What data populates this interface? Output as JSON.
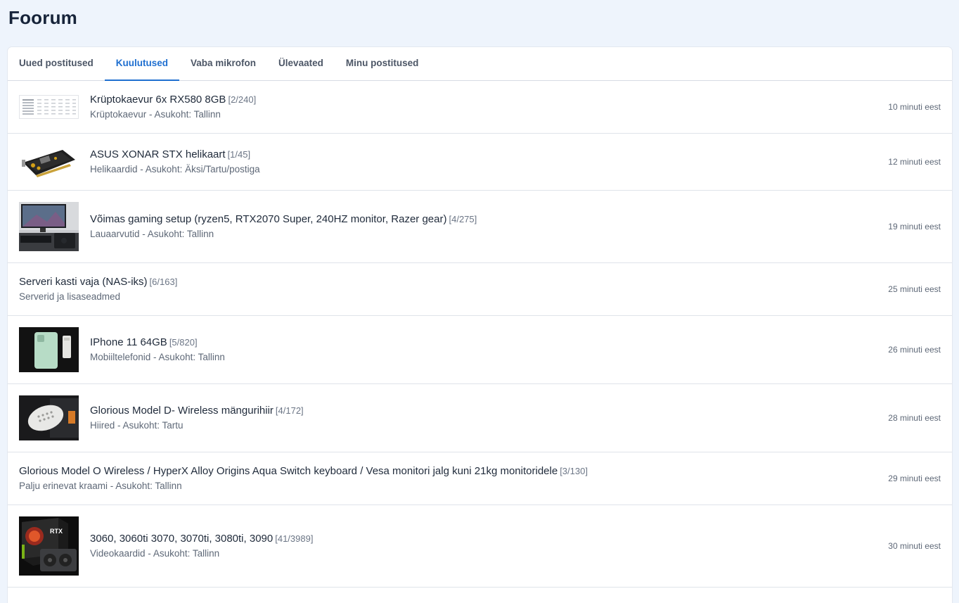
{
  "page": {
    "title": "Foorum"
  },
  "tabs": [
    {
      "label": "Uued postitused",
      "active": false
    },
    {
      "label": "Kuulutused",
      "active": true
    },
    {
      "label": "Vaba mikrofon",
      "active": false
    },
    {
      "label": "Ülevaated",
      "active": false
    },
    {
      "label": "Minu postitused",
      "active": false
    }
  ],
  "posts": [
    {
      "title": "Krüptokaevur 6x RX580 8GB",
      "count": "[2/240]",
      "subtitle": "Krüptokaevur - Asukoht: Tallinn",
      "time": "10 minuti eest",
      "thumbnail": "spreadsheet-screenshot"
    },
    {
      "title": "ASUS XONAR STX helikaart",
      "count": "[1/45]",
      "subtitle": "Helikaardid - Asukoht: Äksi/Tartu/postiga",
      "time": "12 minuti eest",
      "thumbnail": "sound-card"
    },
    {
      "title": "Võimas gaming setup (ryzen5, RTX2070 Super, 240HZ monitor, Razer gear)",
      "count": "[4/275]",
      "subtitle": "Lauaarvutid - Asukoht: Tallinn",
      "time": "19 minuti eest",
      "thumbnail": "gaming-desk"
    },
    {
      "title": "Serveri kasti vaja (NAS-iks)",
      "count": "[6/163]",
      "subtitle": "Serverid ja lisaseadmed",
      "time": "25 minuti eest",
      "thumbnail": null
    },
    {
      "title": "IPhone 11 64GB",
      "count": "[5/820]",
      "subtitle": "Mobiiltelefonid - Asukoht: Tallinn",
      "time": "26 minuti eest",
      "thumbnail": "phone"
    },
    {
      "title": "Glorious Model D- Wireless mängurihiir",
      "count": "[4/172]",
      "subtitle": "Hiired - Asukoht: Tartu",
      "time": "28 minuti eest",
      "thumbnail": "mouse"
    },
    {
      "title": "Glorious Model O Wireless / HyperX Alloy Origins Aqua Switch keyboard / Vesa monitori jalg kuni 21kg monitoridele",
      "count": "[3/130]",
      "subtitle": "Palju erinevat kraami - Asukoht: Tallinn",
      "time": "29 minuti eest",
      "thumbnail": null
    },
    {
      "title": "3060, 3060ti 3070, 3070ti, 3080ti, 3090",
      "count": "[41/3989]",
      "subtitle": "Videokaardid - Asukoht: Tallinn",
      "time": "30 minuti eest",
      "thumbnail": "gpu-box",
      "thumb_text": "RTX"
    }
  ],
  "colors": {
    "background": "#eef4fc",
    "accent": "#1f6fd0",
    "text": "#1f2a3a",
    "muted": "#5e6877"
  }
}
